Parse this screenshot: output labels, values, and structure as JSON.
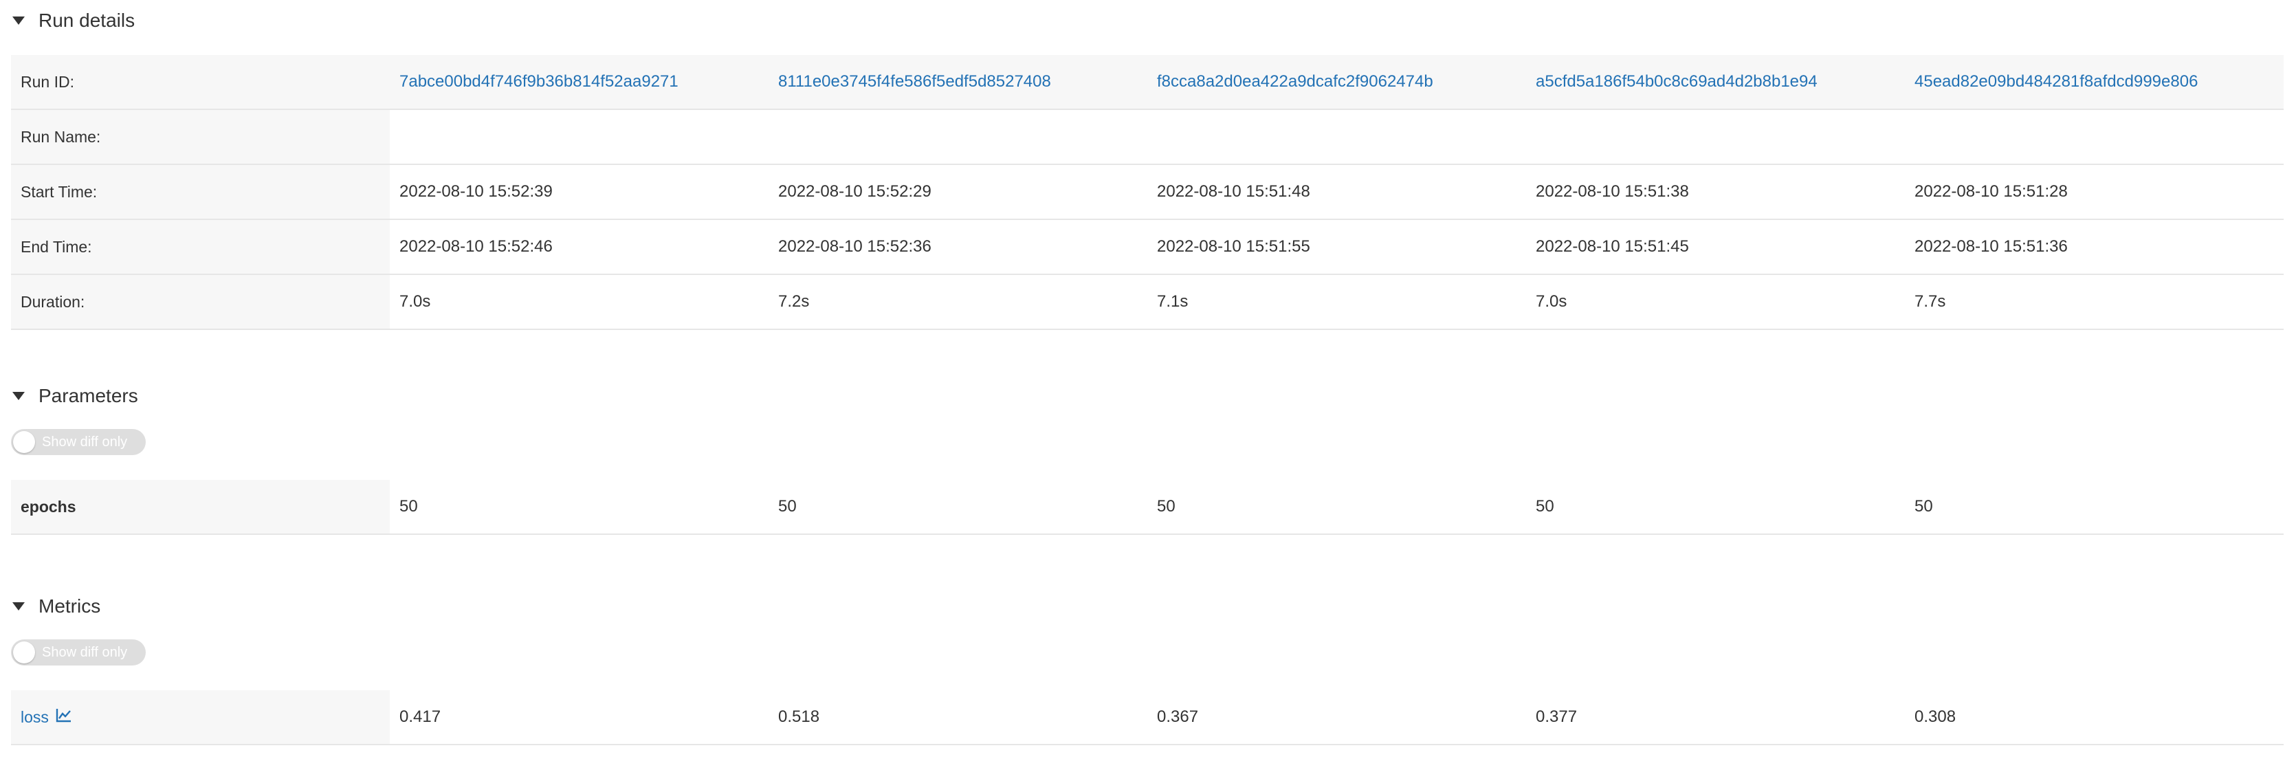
{
  "run_details": {
    "title": "Run details",
    "rows": {
      "run_id": {
        "label": "Run ID:",
        "values": [
          "7abce00bd4f746f9b36b814f52aa9271",
          "8111e0e3745f4fe586f5edf5d8527408",
          "f8cca8a2d0ea422a9dcafc2f9062474b",
          "a5cfd5a186f54b0c8c69ad4d2b8b1e94",
          "45ead82e09bd484281f8afdcd999e806"
        ]
      },
      "run_name": {
        "label": "Run Name:"
      },
      "start_time": {
        "label": "Start Time:",
        "values": [
          "2022-08-10 15:52:39",
          "2022-08-10 15:52:29",
          "2022-08-10 15:51:48",
          "2022-08-10 15:51:38",
          "2022-08-10 15:51:28"
        ]
      },
      "end_time": {
        "label": "End Time:",
        "values": [
          "2022-08-10 15:52:46",
          "2022-08-10 15:52:36",
          "2022-08-10 15:51:55",
          "2022-08-10 15:51:45",
          "2022-08-10 15:51:36"
        ]
      },
      "duration": {
        "label": "Duration:",
        "values": [
          "7.0s",
          "7.2s",
          "7.1s",
          "7.0s",
          "7.7s"
        ]
      }
    }
  },
  "parameters": {
    "title": "Parameters",
    "toggle_label": "Show diff only",
    "rows": {
      "epochs": {
        "label": "epochs",
        "values": [
          "50",
          "50",
          "50",
          "50",
          "50"
        ]
      }
    }
  },
  "metrics": {
    "title": "Metrics",
    "toggle_label": "Show diff only",
    "rows": {
      "loss": {
        "label": "loss",
        "icon": "line-chart-icon",
        "values": [
          "0.417",
          "0.518",
          "0.367",
          "0.377",
          "0.308"
        ]
      }
    }
  },
  "colors": {
    "link": "#2372b5",
    "label_bg": "#f7f7f7",
    "toggle_bg": "#dedede",
    "border": "#e6e6e6"
  }
}
